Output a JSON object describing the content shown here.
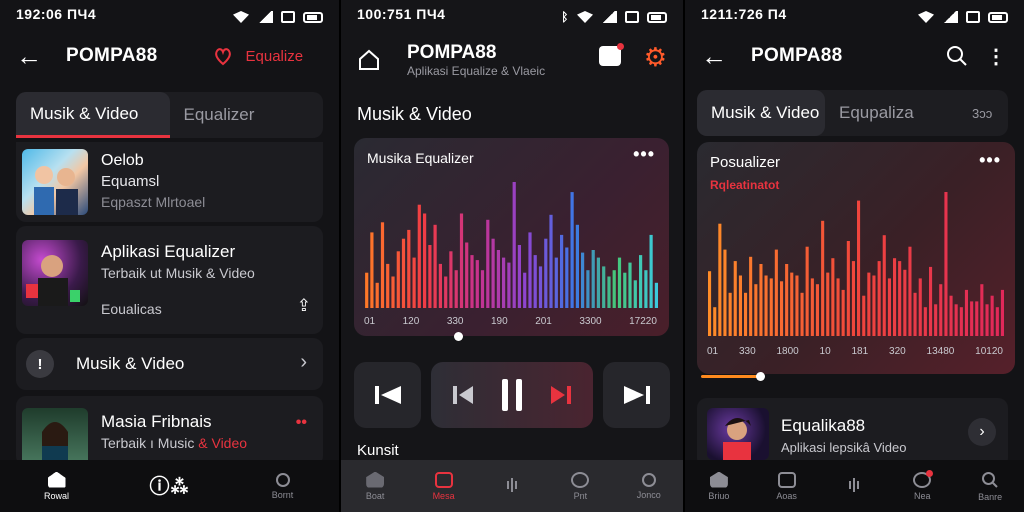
{
  "screen1": {
    "status_time": "192:06 ПЧ4",
    "app_title": "POMPA88",
    "header_action": "Equalize",
    "tabs": [
      "Musik & Video",
      "Equalizer"
    ],
    "items": [
      {
        "line1": "Oelob",
        "line2": "Equamsl",
        "line3": "Eqpaszt Mlrtoael"
      },
      {
        "line1": "Aplikasi Equalizer",
        "line2": "Terbaik ut Musik & Video",
        "line3": "Eoualicas"
      },
      {
        "line1": "Musik & Video"
      },
      {
        "line1": "Masia Fribnais",
        "line2_prefix": "Terbaik ı Music ",
        "line2_accent": "& Video"
      }
    ],
    "nav": [
      {
        "label": "Rowal",
        "icon": "home-icon"
      },
      {
        "label": "",
        "icon": "equalizer-icon"
      },
      {
        "label": "Bornt",
        "icon": "profile-icon"
      }
    ]
  },
  "screen2": {
    "status_time": "100:751 ПЧ4",
    "app_title": "POMPA88",
    "app_subtitle": "Aplikasi Equalize & Vlaeic",
    "section_title": "Musik & Video",
    "eq_title": "Musika Equalizer",
    "x_ticks": [
      "01",
      "120",
      "330",
      "190",
      "201",
      "3300",
      "17220"
    ],
    "footer_label": "Kunsit",
    "nav": [
      {
        "label": "Boat",
        "icon": "home-icon"
      },
      {
        "label": "Mesa",
        "icon": "square-icon"
      },
      {
        "label": "",
        "icon": "wave-icon"
      },
      {
        "label": "Pnt",
        "icon": "heart-icon"
      },
      {
        "label": "Jonco",
        "icon": "profile-icon"
      }
    ],
    "progress": 0.33
  },
  "screen3": {
    "status_time": "1211:726 П4",
    "app_title": "POMPA88",
    "tabs": [
      "Musik & Video",
      "Equpaliza",
      "3ᴐᴐ"
    ],
    "eq_title": "Posualizer",
    "eq_subtitle": "Rqleatinatot",
    "x_ticks": [
      "01",
      "330",
      "1800",
      "10",
      "181",
      "320",
      "13480",
      "10120"
    ],
    "track_title": "Equalika88",
    "track_subtitle": "Aplikasi lepsikâ Video",
    "slider_value": 0.19,
    "nav": [
      {
        "label": "Briuo",
        "icon": "home-icon"
      },
      {
        "label": "Aoas",
        "icon": "square-icon"
      },
      {
        "label": "",
        "icon": "wave-icon"
      },
      {
        "label": "Nea",
        "icon": "heart-icon"
      },
      {
        "label": "Banre",
        "icon": "search-icon"
      }
    ]
  },
  "colors": {
    "accent": "#e8333f",
    "orange": "#ff8a1e",
    "background": "#131316"
  },
  "chart_data": [
    {
      "type": "bar",
      "title": "Musika Equalizer",
      "categories": [
        "01",
        "120",
        "330",
        "190",
        "201",
        "3300",
        "17220"
      ],
      "values": [
        0.28,
        0.6,
        0.2,
        0.68,
        0.35,
        0.25,
        0.45,
        0.55,
        0.62,
        0.4,
        0.82,
        0.75,
        0.5,
        0.66,
        0.35,
        0.25,
        0.45,
        0.3,
        0.75,
        0.52,
        0.42,
        0.38,
        0.3,
        0.7,
        0.55,
        0.46,
        0.4,
        0.36,
        1.0,
        0.5,
        0.28,
        0.6,
        0.42,
        0.33,
        0.55,
        0.74,
        0.4,
        0.58,
        0.48,
        0.92,
        0.66,
        0.44,
        0.3,
        0.46,
        0.4,
        0.33,
        0.25,
        0.3,
        0.4,
        0.28,
        0.36,
        0.22,
        0.42,
        0.3,
        0.58,
        0.2
      ],
      "ylim": [
        0,
        1
      ]
    },
    {
      "type": "bar",
      "title": "Posualizer",
      "categories": [
        "01",
        "330",
        "1800",
        "10",
        "181",
        "320",
        "13480",
        "10120"
      ],
      "values": [
        0.45,
        0.2,
        0.78,
        0.6,
        0.3,
        0.52,
        0.42,
        0.3,
        0.55,
        0.36,
        0.5,
        0.42,
        0.4,
        0.6,
        0.38,
        0.5,
        0.44,
        0.42,
        0.3,
        0.62,
        0.4,
        0.36,
        0.8,
        0.44,
        0.54,
        0.4,
        0.32,
        0.66,
        0.52,
        0.94,
        0.28,
        0.44,
        0.42,
        0.52,
        0.7,
        0.4,
        0.54,
        0.52,
        0.46,
        0.62,
        0.3,
        0.4,
        0.2,
        0.48,
        0.22,
        0.36,
        1.0,
        0.28,
        0.22,
        0.2,
        0.32,
        0.24,
        0.24,
        0.36,
        0.22,
        0.28,
        0.2,
        0.32
      ],
      "ylim": [
        0,
        1
      ]
    }
  ]
}
